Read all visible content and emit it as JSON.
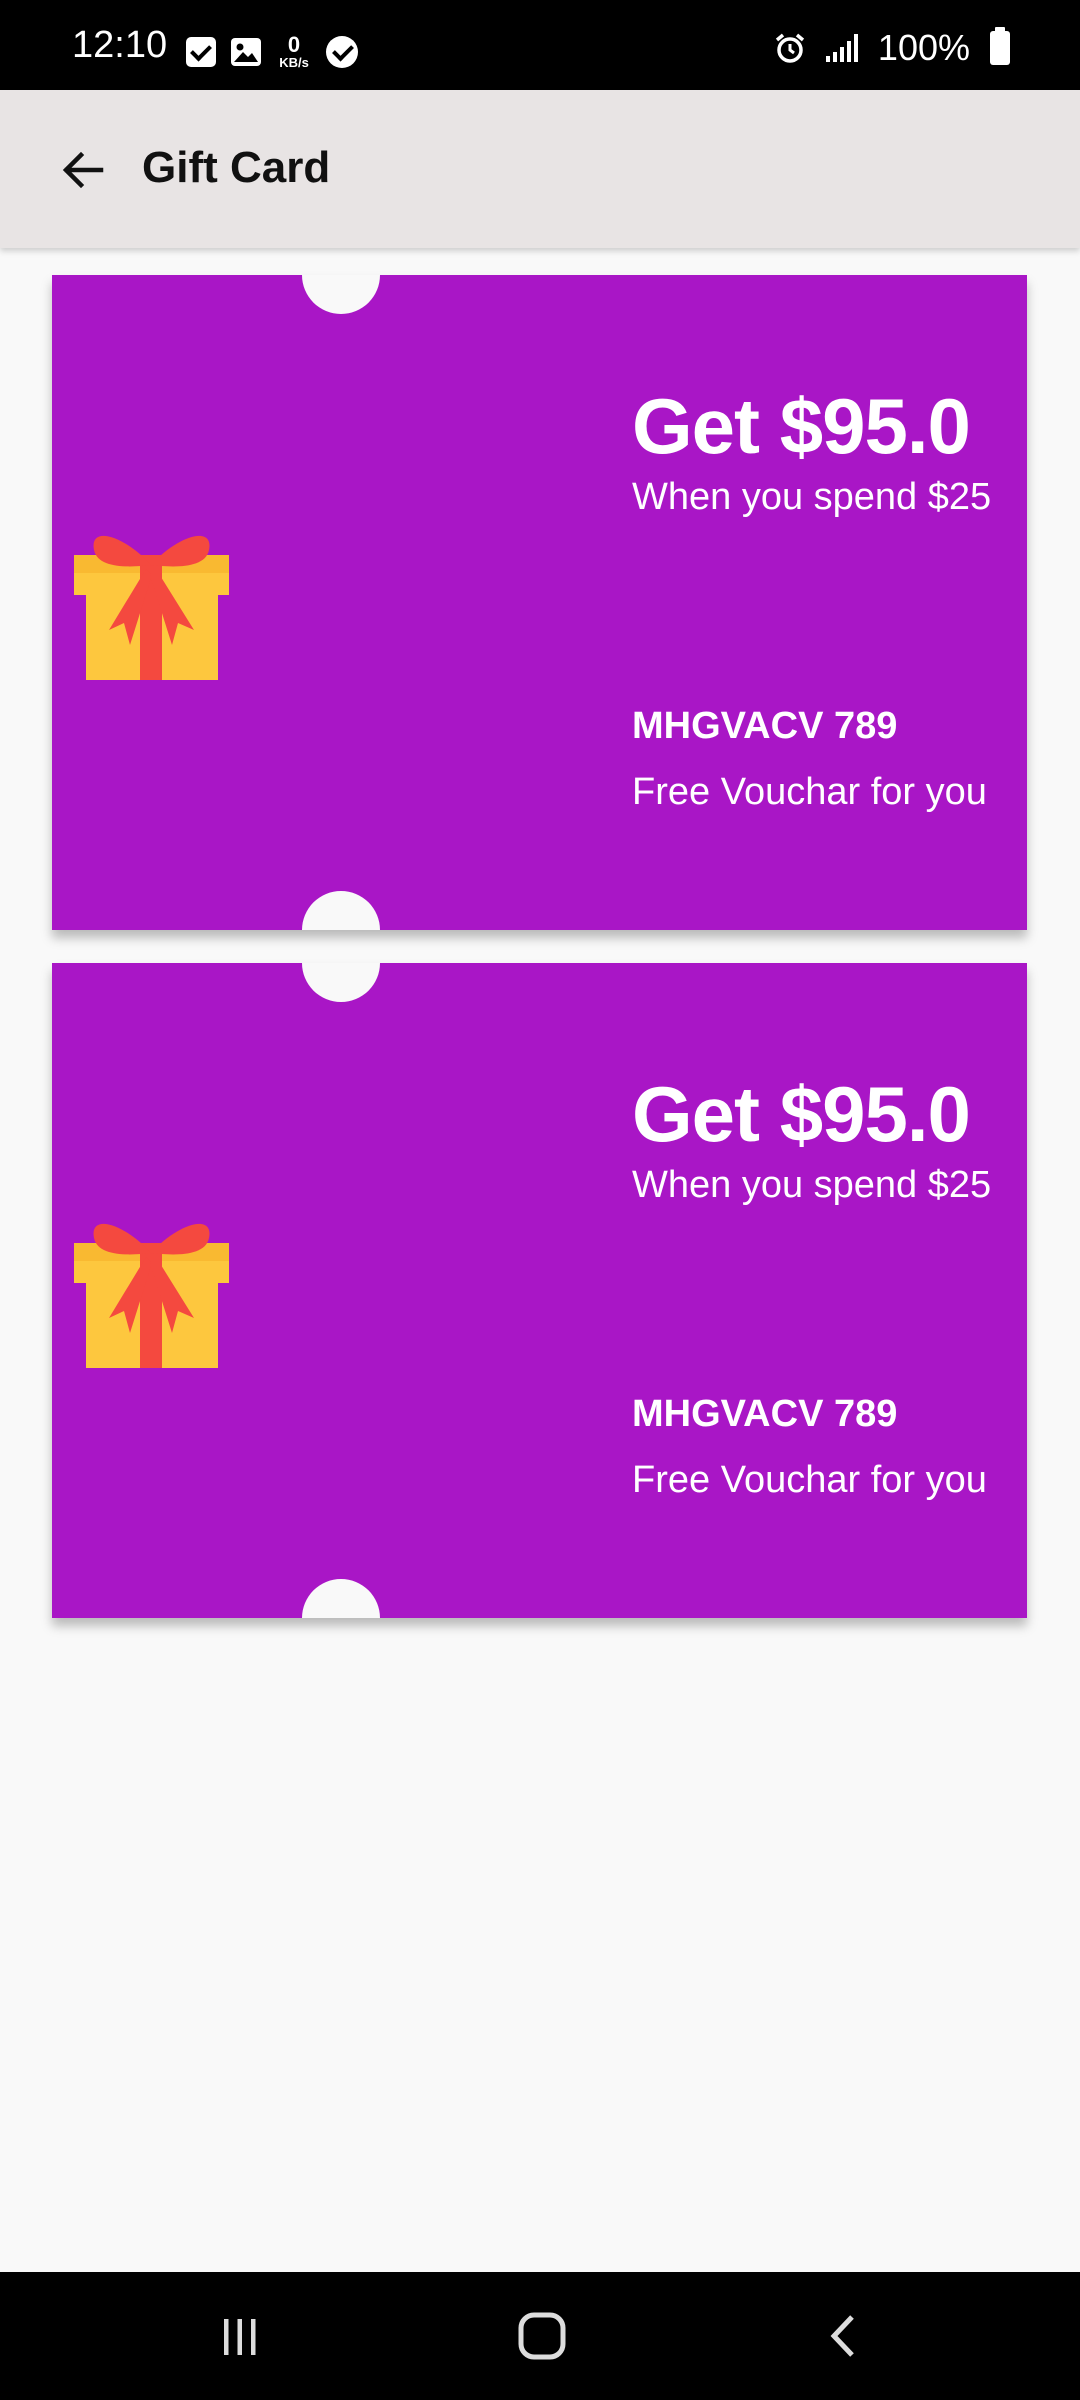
{
  "status_bar": {
    "time": "12:10",
    "kbs_value": "0",
    "kbs_unit": "KB/s",
    "battery": "100%"
  },
  "app_bar": {
    "title": "Gift Card",
    "back_icon": "arrow-left-icon"
  },
  "cards": [
    {
      "amount": "Get $95.0",
      "condition": "When you spend $25",
      "code": "MHGVACV 789",
      "tagline": "Free Vouchar for you",
      "icon": "gift-box-icon"
    },
    {
      "amount": "Get $95.0",
      "condition": "When you spend $25",
      "code": "MHGVACV 789",
      "tagline": "Free Vouchar for you",
      "icon": "gift-box-icon"
    }
  ],
  "colors": {
    "card_background": "#a916c6",
    "app_bar": "#e8e4e4",
    "page_background": "#f9f9f9",
    "gift_box": "#fdc73e",
    "gift_ribbon": "#f4493f"
  },
  "nav_bar": {
    "recents_icon": "recents-icon",
    "home_icon": "home-icon",
    "back_icon": "back-chevron-icon"
  }
}
